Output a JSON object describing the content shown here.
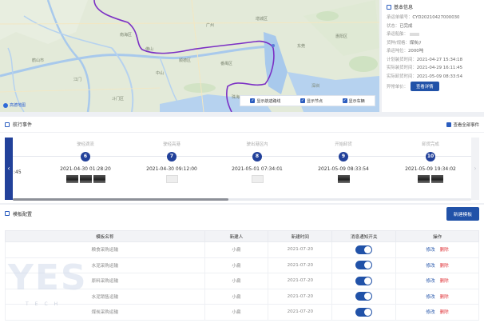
{
  "map": {
    "logo_text": "高德地图",
    "labels": [
      "广州",
      "佛山",
      "中山",
      "番禺区",
      "东莞",
      "深圳",
      "江门",
      "南海区",
      "顺德区",
      "增城区",
      "惠阳区",
      "珠海",
      "斗门区",
      "鹤山市"
    ],
    "legend": [
      "显示航迹路线",
      "显示节点",
      "显示车辆"
    ]
  },
  "basic_info": {
    "title": "基本信息",
    "rows": [
      {
        "key": "承运单编号：",
        "value": "CYD20210427000030"
      },
      {
        "key": "状态：",
        "value": "已完成"
      },
      {
        "key": "承运船舶：",
        "value": ""
      },
      {
        "key": "货种/规格：",
        "value": "煤炭//"
      },
      {
        "key": "承运吨位：",
        "value": "2000吨"
      },
      {
        "key": "计划装货时间：",
        "value": "2021-04-27 15:34:18"
      },
      {
        "key": "实际装货时间：",
        "value": "2021-04-29 16:11:45"
      },
      {
        "key": "实际卸货时间：",
        "value": "2021-05-09 08:33:54"
      }
    ],
    "abnormal_label": "异常单价：",
    "detail_button": "查看详情"
  },
  "events": {
    "title": "航行事件",
    "view_all": "查看全部事件",
    "partial_time": ":45",
    "items": [
      {
        "name": "驶经滴流",
        "num": "6",
        "time": "2021-04-30 01:28:20",
        "thumbs": [
          "dark",
          "dark",
          "dark"
        ]
      },
      {
        "name": "驶经高港",
        "num": "7",
        "time": "2021-04-30 09:12:00",
        "thumbs": [
          "light"
        ]
      },
      {
        "name": "驶出港区内",
        "num": "8",
        "time": "2021-05-01 07:34:01",
        "thumbs": [
          "light"
        ]
      },
      {
        "name": "开始卸货",
        "num": "9",
        "time": "2021-05-09 08:33:54",
        "thumbs": [
          "dark"
        ]
      },
      {
        "name": "卸货完成",
        "num": "10",
        "time": "2021-05-09 19:34:02",
        "thumbs": [
          "dark",
          "dark"
        ]
      }
    ]
  },
  "templates": {
    "title": "模板配置",
    "new_button": "新建模板",
    "columns": [
      "模板名称",
      "新建人",
      "新建时间",
      "消息通知开关",
      "操作"
    ],
    "edit_label": "修改",
    "delete_label": "删除",
    "rows": [
      {
        "name": "粮食采购运输",
        "creator": "小扁",
        "time": "2021-07-20",
        "toggle": true
      },
      {
        "name": "水泥采购运输",
        "creator": "小扁",
        "time": "2021-07-20",
        "toggle": true
      },
      {
        "name": "原料采购运输",
        "creator": "小扁",
        "time": "2021-07-20",
        "toggle": true
      },
      {
        "name": "水泥销售运输",
        "creator": "小扁",
        "time": "2021-07-20",
        "toggle": true
      },
      {
        "name": "煤炭采购运输",
        "creator": "小扁",
        "time": "2021-07-20",
        "toggle": true
      }
    ]
  },
  "watermark": {
    "main": "YES",
    "sub": "TECH"
  },
  "colors": {
    "primary": "#2152a8",
    "danger": "#e0363b",
    "route": "#7b2fc4"
  }
}
